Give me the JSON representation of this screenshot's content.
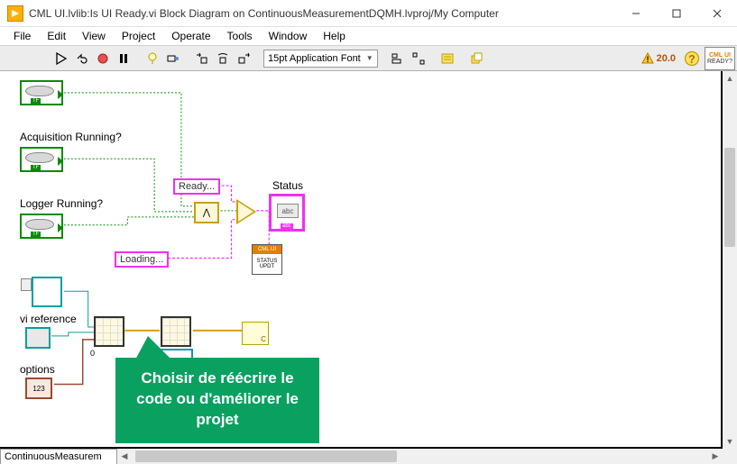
{
  "titlebar": {
    "title": "CML UI.lvlib:Is UI Ready.vi Block Diagram on ContinuousMeasurementDQMH.lvproj/My Computer"
  },
  "menu": {
    "file": "File",
    "edit": "Edit",
    "view": "View",
    "project": "Project",
    "operate": "Operate",
    "tools": "Tools",
    "window": "Window",
    "help": "Help"
  },
  "toolbar": {
    "font": "15pt Application Font",
    "warn_count": "20.0"
  },
  "ready_badge": {
    "l1": "CML UI",
    "l2": "READY?"
  },
  "diagram": {
    "acq_label": "Acquisition Running?",
    "log_label": "Logger Running?",
    "ready_const": "Ready...",
    "loading_const": "Loading...",
    "status_label": "Status",
    "status_abc": "abc",
    "status_upd_hdr": "CML UI",
    "status_upd_body": "STATUS UPDT",
    "viref_label": "vi reference",
    "options_label": "options",
    "and_symbol": "⋀",
    "arr_idx": "0",
    "clust": "123",
    "scroll_c": "C"
  },
  "tabstrip": {
    "label": "ContinuousMeasurem"
  },
  "callout": {
    "text": "Choisir de réécrire le code ou d'améliorer le projet"
  }
}
